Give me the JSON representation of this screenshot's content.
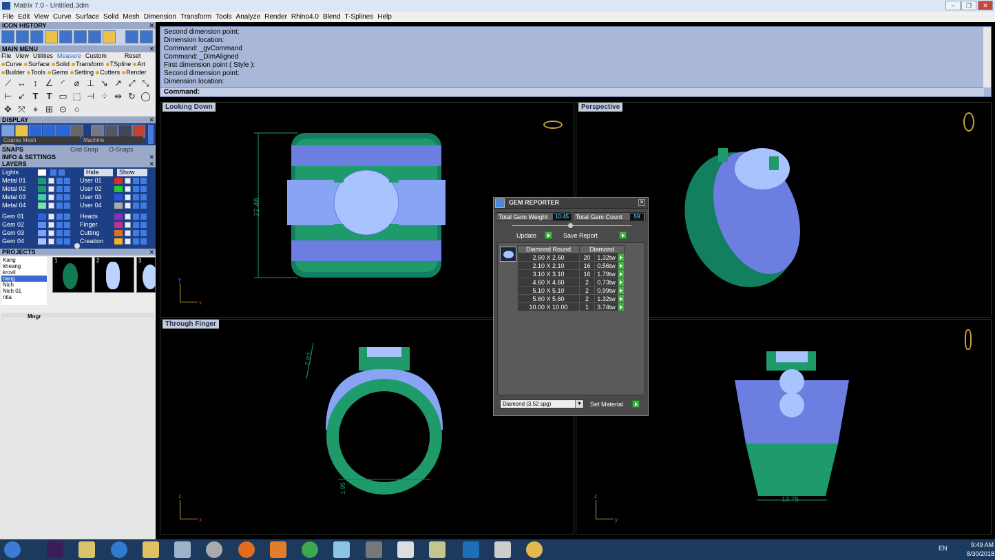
{
  "window": {
    "title": "Matrix 7.0 - Untitled.3dm"
  },
  "menu": [
    "File",
    "Edit",
    "View",
    "Curve",
    "Surface",
    "Solid",
    "Mesh",
    "Dimension",
    "Transform",
    "Tools",
    "Analyze",
    "Render",
    "Rhino4.0",
    "Blend",
    "T-Splines",
    "Help"
  ],
  "left": {
    "icon_history": "ICON HISTORY",
    "main_menu": "MAIN MENU",
    "tabs": [
      "File",
      "View",
      "Utilities",
      "Measure",
      "Custom"
    ],
    "active_tab": "Measure",
    "reset": "Reset",
    "categories1": [
      "Curve",
      "Surface",
      "Solid",
      "Transform",
      "TSpline",
      "Art"
    ],
    "categories2": [
      "Builder",
      "Tools",
      "Gems",
      "Setting",
      "Cutters",
      "Render"
    ],
    "display": "DISPLAY",
    "mesh_select": "Coarse Mesh",
    "material_select": "Machine",
    "snaps": "SNAPS",
    "grid_snap": "Grid Snap",
    "o_snaps": "O-Snaps",
    "info": "INFO & SETTINGS",
    "layers": "LAYERS",
    "lights": "Lights",
    "hide": "Hide",
    "show": "Show",
    "layer_left": [
      "Metal 01",
      "Metal 02",
      "Metal 03",
      "Metal 04",
      "Gem 01",
      "Gem 02",
      "Gem 03",
      "Gem 04"
    ],
    "layer_right": [
      "User 01",
      "User 02",
      "User 03",
      "User 04",
      "Heads",
      "Finger",
      "Cutting",
      "Creation"
    ],
    "projects": "PROJECTS",
    "project_list": [
      "Kang",
      "kheang",
      "krovil",
      "nang",
      "Nich",
      "Nich 01",
      "nita"
    ],
    "selected_project": "nang",
    "thumb_nums": [
      "1",
      "2",
      "3"
    ],
    "mngr": "Mngr"
  },
  "command": {
    "lines": [
      "Second dimension point:",
      "Dimension location:",
      "Command: _gvCommand",
      "Command: _DimAligned",
      "First dimension point ( Style ):",
      "Second dimension point:",
      "Dimension location:"
    ],
    "prompt": "Command:"
  },
  "viewports": {
    "top_left": "Looking Down",
    "top_right": "Perspective",
    "bottom_left": "Through Finger",
    "dim_height": "22.48",
    "dim_top": "7.83",
    "dim_bottom": "1.95",
    "dim_width": "13.75"
  },
  "gem_reporter": {
    "title": "GEM REPORTER",
    "weight_label": "Total Gem Weight",
    "weight_value": "10.45",
    "count_label": "Total Gem Count",
    "count_value": "59",
    "update": "Update",
    "save_report": "Save Report",
    "col1": "Diamond Round",
    "col2": "Diamond",
    "rows": [
      {
        "size": "2.60 X 2.60",
        "count": "20",
        "tw": "1.32tw"
      },
      {
        "size": "2.10 X 2.10",
        "count": "16",
        "tw": "0.56tw"
      },
      {
        "size": "3.10 X 3.10",
        "count": "16",
        "tw": "1.79tw"
      },
      {
        "size": "4.60 X 4.60",
        "count": "2",
        "tw": "0.73tw"
      },
      {
        "size": "5.10 X 5.10",
        "count": "2",
        "tw": "0.99tw"
      },
      {
        "size": "5.60 X 5.60",
        "count": "2",
        "tw": "1.32tw"
      },
      {
        "size": "10.00 X 10.00",
        "count": "1",
        "tw": "3.74tw"
      }
    ],
    "material": "Diamond    (3.52 spg)",
    "set_material": "Set Material"
  },
  "taskbar": {
    "lang": "EN",
    "time": "9:49 AM",
    "date": "8/30/2018"
  },
  "colors": {
    "ring_green": "#1f9a6a",
    "gem_blue": "#a9c3ff",
    "accent_purple": "#8a2fb0",
    "panel_blue": "#1d3f86"
  }
}
